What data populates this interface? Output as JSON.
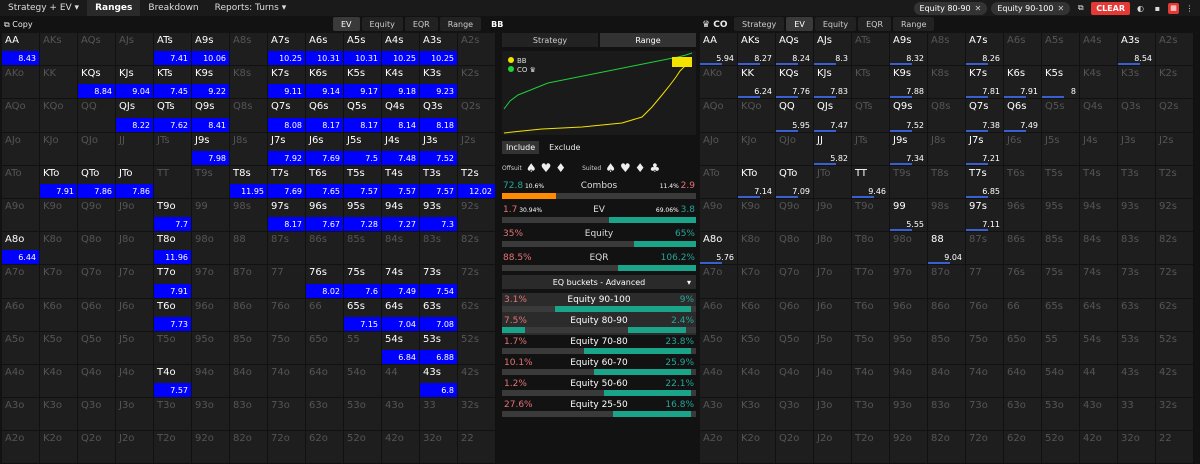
{
  "topbar": {
    "mode": "Strategy + EV",
    "tabs": [
      "Ranges",
      "Breakdown",
      "Reports: Turns"
    ],
    "filters": [
      "Equity 80-90",
      "Equity 90-100"
    ],
    "clear": "CLEAR"
  },
  "left": {
    "copy": "Copy",
    "tabs": [
      "EV",
      "Equity",
      "EQR",
      "Range"
    ],
    "player": "BB"
  },
  "right": {
    "player": "CO",
    "crown": "♛",
    "tabs": [
      "Strategy",
      "EV",
      "Equity",
      "EQR",
      "Range"
    ]
  },
  "mid": {
    "tabs": [
      "Strategy",
      "Range"
    ],
    "legend": [
      "BB",
      "CO ♛"
    ],
    "include": "Include",
    "exclude": "Exclude",
    "offsuit": "Offsuit",
    "suited": "Suited",
    "stats": [
      {
        "l": "72.8",
        "lsub": "10.6%",
        "c": "Combos",
        "rsub": "11.4%",
        "r": "2.9",
        "lf": 0.28,
        "rf": 0
      },
      {
        "l": "1.7",
        "lsub": "30.94%",
        "c": "EV",
        "rsub": "69.06%",
        "r": "3.8",
        "lf": 0,
        "rf": 0.45
      },
      {
        "l": "35%",
        "lsub": "",
        "c": "Equity",
        "rsub": "",
        "r": "65%",
        "lf": 0,
        "rf": 0.32
      },
      {
        "l": "88.5%",
        "lsub": "",
        "c": "EQR",
        "rsub": "",
        "r": "106.2%",
        "lf": 0,
        "rf": 0.4
      }
    ],
    "dropdown": "EQ buckets - Advanced",
    "buckets": [
      {
        "c": "Equity 90-100",
        "l": "3.1%",
        "r": "9%",
        "lf": 0,
        "rf": 0.7,
        "sel": true
      },
      {
        "c": "Equity 80-90",
        "l": "7.5%",
        "r": "2.4%",
        "lf": 0.12,
        "rf": 0.3,
        "sel": true
      },
      {
        "c": "Equity 70-80",
        "l": "1.7%",
        "r": "23.8%",
        "lf": 0,
        "rf": 0.55,
        "sel": false
      },
      {
        "c": "Equity 60-70",
        "l": "10.1%",
        "r": "25.9%",
        "lf": 0,
        "rf": 0.5,
        "sel": false
      },
      {
        "c": "Equity 50-60",
        "l": "1.2%",
        "r": "22.1%",
        "lf": 0,
        "rf": 0.45,
        "sel": false
      },
      {
        "c": "Equity 25-50",
        "l": "27.6%",
        "r": "16.8%",
        "lf": 0,
        "rf": 0.4,
        "sel": false
      }
    ]
  },
  "bbCells": {
    "AA": "8.43",
    "ATs": "7.41",
    "A9s": "10.06",
    "A7s": "10.25",
    "A6s": "10.31",
    "A5s": "10.31",
    "A4s": "10.25",
    "A3s": "10.25",
    "KQs": "8.84",
    "KJs": "9.04",
    "KTs": "7.45",
    "K9s": "9.22",
    "K7s": "9.11",
    "K6s": "9.14",
    "K5s": "9.17",
    "K4s": "9.18",
    "K3s": "9.23",
    "QJs": "8.22",
    "QTs": "7.62",
    "Q9s": "8.41",
    "Q7s": "8.08",
    "Q6s": "8.17",
    "Q5s": "8.17",
    "Q4s": "8.14",
    "Q3s": "8.18",
    "J9s": "7.98",
    "J7s": "7.92",
    "J6s": "7.69",
    "J5s": "7.5",
    "J4s": "7.48",
    "J3s": "7.52",
    "KTo": "7.91",
    "QTo": "7.86",
    "JTo": "7.86",
    "T8s": "11.95",
    "T7s": "7.69",
    "T6s": "7.65",
    "T5s": "7.57",
    "T4s": "7.57",
    "T3s": "7.57",
    "T2s": "12.02",
    "T9o": "7.7",
    "97s": "8.17",
    "96s": "7.67",
    "95s": "7.28",
    "94s": "7.27",
    "93s": "7.3",
    "A8o": "6.44",
    "T8o": "11.96",
    "T7o": "7.91",
    "76s": "8.02",
    "75s": "7.6",
    "74s": "7.49",
    "73s": "7.54",
    "T6o": "7.73",
    "65s": "7.15",
    "64s": "7.04",
    "63s": "7.08",
    "54s": "6.84",
    "53s": "6.88",
    "T4o": "7.57",
    "43s": "6.8"
  },
  "coCells": {
    "AA": "5.94",
    "AKs": "8.27",
    "AQs": "8.24",
    "AJs": "8.3",
    "A9s": "8.32",
    "A7s": "8.26",
    "A3s": "8.54",
    "KK": "6.24",
    "KQs": "7.76",
    "KJs": "7.83",
    "K9s": "7.88",
    "K7s": "7.81",
    "K6s": "7.91",
    "K5s": "8",
    "QQ": "5.95",
    "QJs": "7.47",
    "Q9s": "7.52",
    "Q7s": "7.38",
    "Q6s": "7.49",
    "JJ": "5.82",
    "J9s": "7.34",
    "J7s": "7.21",
    "KTo": "7.14",
    "QTo": "7.09",
    "TT": "9.46",
    "T7s": "6.85",
    "99": "5.55",
    "97s": "7.11",
    "A8o": "5.76",
    "88": "9.04"
  }
}
